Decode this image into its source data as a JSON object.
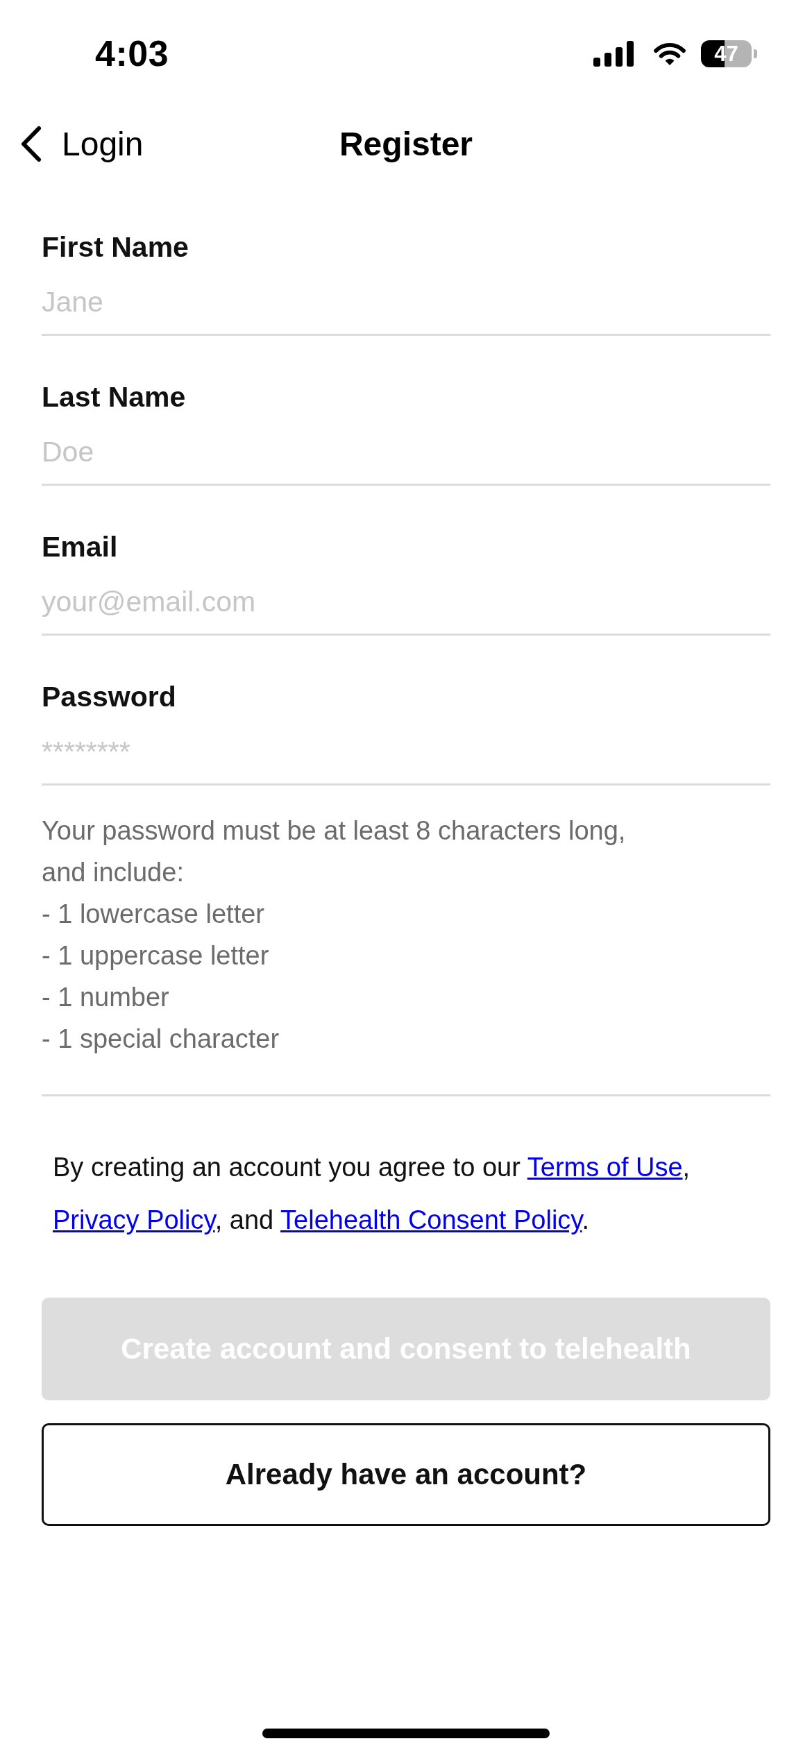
{
  "status_bar": {
    "time": "4:03",
    "battery": "47"
  },
  "nav": {
    "back_label": "Login",
    "title": "Register"
  },
  "fields": [
    {
      "label": "First Name",
      "placeholder": "Jane"
    },
    {
      "label": "Last Name",
      "placeholder": "Doe"
    },
    {
      "label": "Email",
      "placeholder": "your@email.com"
    },
    {
      "label": "Password",
      "placeholder": "********"
    }
  ],
  "password_hint": {
    "intro": "Your password must be at least 8 characters long, and include:",
    "requirements": [
      "- 1 lowercase letter",
      "- 1 uppercase letter",
      "- 1 number",
      "- 1 special character"
    ]
  },
  "consent": [
    {
      "kind": "text",
      "text": "By creating an account you agree to our "
    },
    {
      "kind": "link",
      "text": "Terms of Use"
    },
    {
      "kind": "text",
      "text": ", "
    },
    {
      "kind": "link",
      "text": "Privacy Policy"
    },
    {
      "kind": "text",
      "text": ", and "
    },
    {
      "kind": "link",
      "text": "Telehealth Consent Policy"
    },
    {
      "kind": "text",
      "text": "."
    }
  ],
  "buttons": [
    {
      "kind": "primary",
      "label": "Create account and consent to telehealth",
      "disabled": true
    },
    {
      "kind": "outline",
      "label": "Already have an account?",
      "disabled": false
    }
  ]
}
